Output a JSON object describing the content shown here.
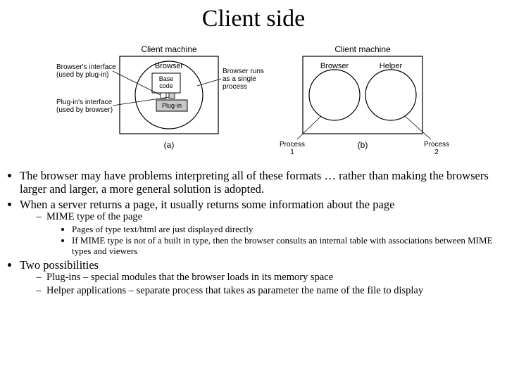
{
  "title": "Client side",
  "figure": {
    "a": {
      "machine_label": "Client machine",
      "browser_label": "Browser",
      "base_code_label": "Base\ncode",
      "plugin_label": "Plug-in",
      "annot_browser_interface": "Browser's interface\n(used by plug-in)",
      "annot_plugin_interface": "Plug-in's interface\n(used by browser)",
      "annot_single_process": "Browser runs\nas a single\nprocess",
      "caption": "(a)"
    },
    "b": {
      "machine_label": "Client machine",
      "browser_label": "Browser",
      "helper_label": "Helper",
      "process1": "Process\n1",
      "process2": "Process\n2",
      "caption": "(b)"
    }
  },
  "bullets": {
    "b1": "The browser may have problems interpreting all of these formats … rather than making the browsers larger and larger, a more general solution is adopted.",
    "b2": "When a server returns a page, it usually returns some information about the page",
    "b2_1": "MIME type of the page",
    "b2_1_1": "Pages of type text/html are just displayed directly",
    "b2_1_2": "If MIME type is not of a built in type, then the browser consults an internal table with associations between MIME types and viewers",
    "b3": "Two possibilities",
    "b3_1": "Plug-ins – special modules that the browser loads in its memory space",
    "b3_2": "Helper applications – separate process that takes as parameter the name of the file to display"
  }
}
